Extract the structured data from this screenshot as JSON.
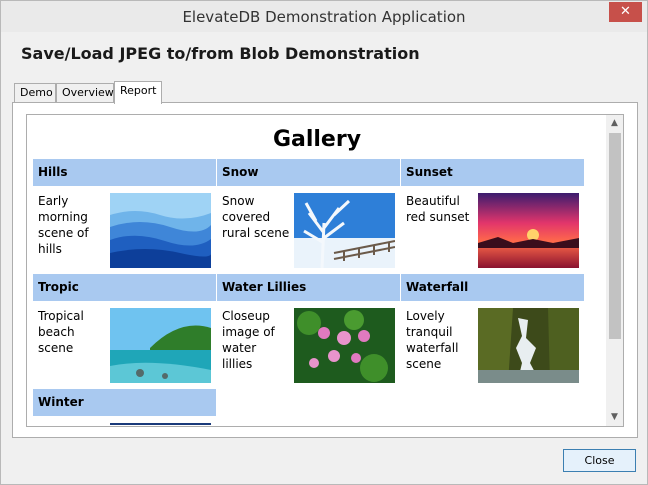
{
  "window": {
    "title": "ElevateDB Demonstration Application",
    "close_glyph": "✕"
  },
  "heading": "Save/Load JPEG to/from Blob Demonstration",
  "tabs": [
    {
      "label": "Demo",
      "active": false
    },
    {
      "label": "Overview",
      "active": false
    },
    {
      "label": "Report",
      "active": true
    }
  ],
  "report": {
    "title": "Gallery",
    "items": [
      {
        "name": "Hills",
        "description": "Early morning scene of hills",
        "image_icon": "hills-image"
      },
      {
        "name": "Snow",
        "description": "Snow covered rural scene",
        "image_icon": "snow-image"
      },
      {
        "name": "Sunset",
        "description": "Beautiful red sunset",
        "image_icon": "sunset-image"
      },
      {
        "name": "Tropic",
        "description": "Tropical beach scene",
        "image_icon": "tropic-image"
      },
      {
        "name": "Water Lillies",
        "description": "Closeup image of water lillies",
        "image_icon": "water-lillies-image"
      },
      {
        "name": "Waterfall",
        "description": "Lovely tranquil waterfall scene",
        "image_icon": "waterfall-image"
      },
      {
        "name": "Winter",
        "description": "",
        "image_icon": "winter-image"
      }
    ]
  },
  "scrollbar": {
    "up_glyph": "▲",
    "down_glyph": "▼"
  },
  "buttons": {
    "close_label": "Close"
  },
  "colors": {
    "header_fill": "#a9c9f0",
    "close_accent": "#c7504a",
    "button_border": "#3c7fb1"
  }
}
